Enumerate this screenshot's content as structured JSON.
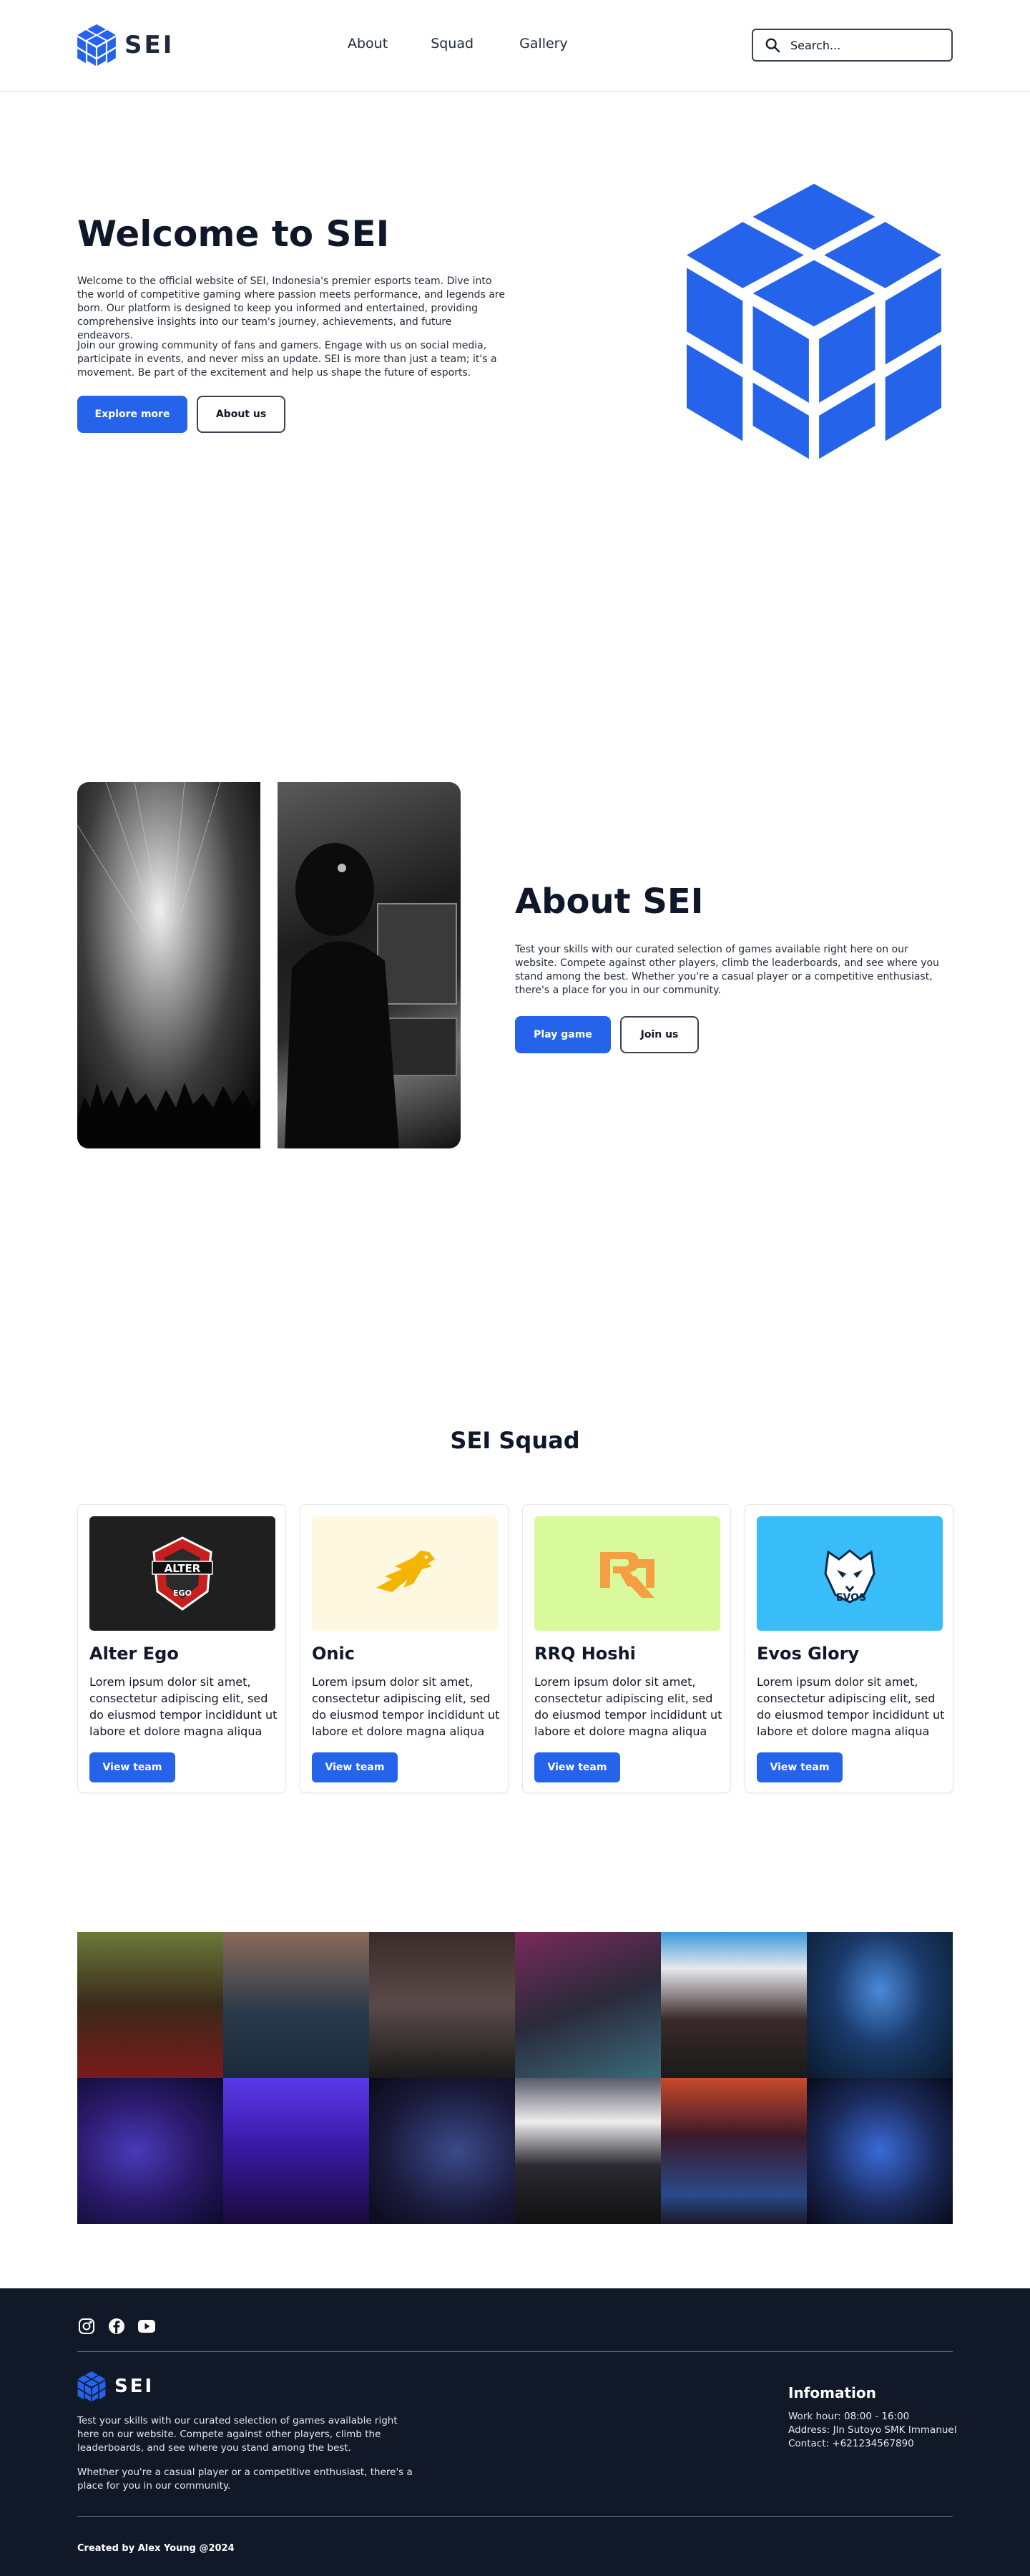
{
  "nav": {
    "brand": "SEI",
    "links": [
      "About",
      "Squad",
      "Gallery"
    ],
    "search_placeholder": "Search..."
  },
  "hero": {
    "title": "Welcome to SEI",
    "p1": "Welcome to the official website of SEI, Indonesia's premier esports team. Dive into the world of competitive gaming where passion meets performance, and legends are born. Our platform is designed to keep you informed and entertained, providing comprehensive insights into our team's journey, achievements, and future endeavors.",
    "p2": "Join our growing community of fans and gamers. Engage with us on social media, participate in events, and never miss an update. SEI is more than just a team; it's a movement. Be part of the excitement and help us shape the future of esports.",
    "primary_button": "Explore more",
    "secondary_button": "About us"
  },
  "about": {
    "title": "About SEI",
    "text": "Test your skills with our curated selection of games available right here on our website. Compete against other players, climb the leaderboards, and see where you stand among the best. Whether you're a casual player or a competitive enthusiast, there's a place for you in our community.",
    "primary_button": "Play game",
    "secondary_button": "Join us"
  },
  "squad": {
    "title": "SEI Squad",
    "cards": [
      {
        "name": "Alter Ego",
        "desc": "Lorem ipsum dolor sit amet, consectetur adipiscing elit, sed do eiusmod tempor incididunt ut labore et dolore magna aliqua",
        "button": "View team",
        "bg": "#1f1f1f",
        "logo_text": "ALTER EGO"
      },
      {
        "name": "Onic",
        "desc": "Lorem ipsum dolor sit amet, consectetur adipiscing elit, sed do eiusmod tempor incididunt ut labore et dolore magna aliqua",
        "button": "View team",
        "bg": "#fef8e1"
      },
      {
        "name": "RRQ Hoshi",
        "desc": "Lorem ipsum dolor sit amet, consectetur adipiscing elit, sed do eiusmod tempor incididunt ut labore et dolore magna aliqua",
        "button": "View team",
        "bg": "#d9f99d"
      },
      {
        "name": "Evos Glory",
        "desc": "Lorem ipsum dolor sit amet, consectetur adipiscing elit, sed do eiusmod tempor incididunt ut labore et dolore magna aliqua",
        "button": "View team",
        "bg": "#38bdf8",
        "logo_text": "EVOS"
      }
    ]
  },
  "gallery": {
    "tiles": [
      "#4a3a2a",
      "#3a5566",
      "#3b2a2a",
      "#2a2438",
      "#5a3a4a",
      "#0f2a4a",
      "#3a2a8a",
      "#4a2aa8",
      "#1a1a3a",
      "#2a2a36",
      "#3a1a2a",
      "#1a2a5a"
    ]
  },
  "footer": {
    "brand": "SEI",
    "p1": "Test your skills with our curated selection of games available right here on our website. Compete against other players, climb the leaderboards, and see where you stand among the best.",
    "p2": "Whether you're a casual player or a competitive enthusiast, there's a place for you in our community.",
    "info_title": "Infomation",
    "info_lines": [
      "Work hour: 08:00 - 16:00",
      "Address: Jln Sutoyo SMK Immanuel",
      "Contact: +621234567890"
    ],
    "credit": "Created by Alex Young @2024",
    "social_icons": [
      "instagram-icon",
      "facebook-icon",
      "youtube-icon"
    ]
  },
  "colors": {
    "accent": "#2563eb",
    "dark": "#111827",
    "footer_bg": "#111827"
  }
}
